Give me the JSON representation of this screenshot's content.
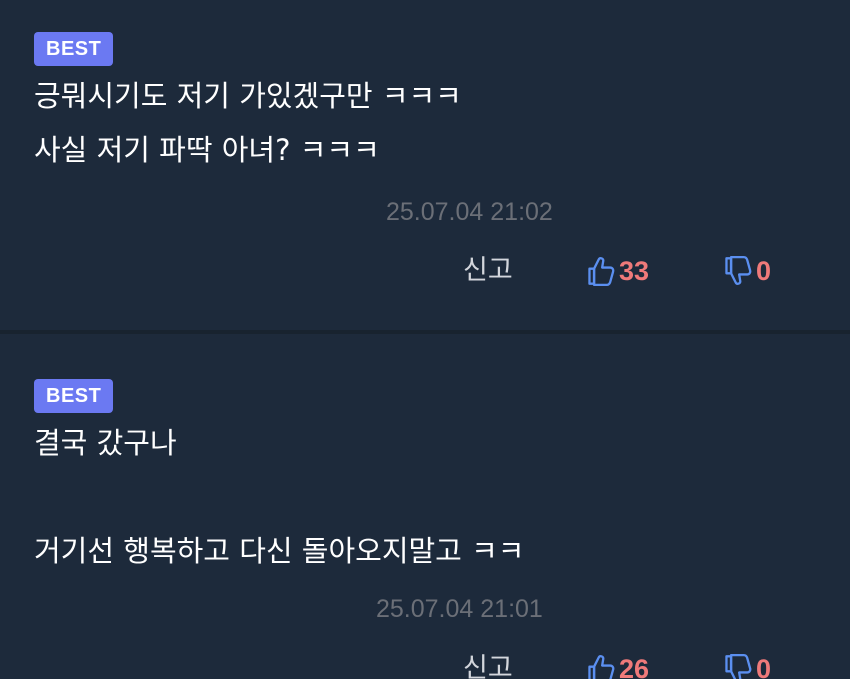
{
  "colors": {
    "background": "#1d2a3b",
    "badge": "#6b79f2",
    "like_icon": "#5b8ff0",
    "dislike_icon": "#5b8ff0",
    "count": "#ef7a7a"
  },
  "icons": {
    "like": "thumbs-up-icon",
    "dislike": "thumbs-down-icon"
  },
  "comments": [
    {
      "badge": "BEST",
      "lines": [
        "긍뭐시기도 저기 가있겠구만 ㅋㅋㅋ",
        "사실 저기 파딱 아녀? ㅋㅋㅋ"
      ],
      "timestamp": "25.07.04 21:02",
      "report_label": "신고",
      "likes": "33",
      "dislikes": "0"
    },
    {
      "badge": "BEST",
      "lines": [
        "결국 갔구나",
        "",
        "거기선 행복하고 다신 돌아오지말고 ㅋㅋ"
      ],
      "timestamp": "25.07.04 21:01",
      "report_label": "신고",
      "likes": "26",
      "dislikes": "0"
    }
  ]
}
